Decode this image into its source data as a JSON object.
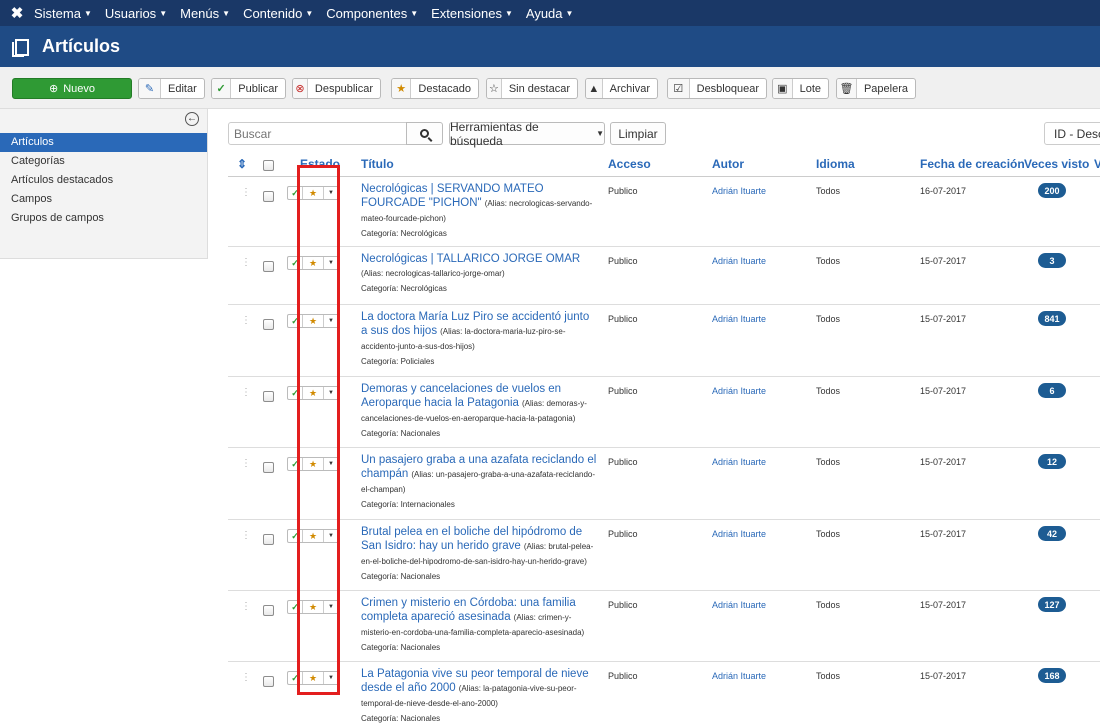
{
  "topnav": {
    "logo_icon": "joomla-logo-icon",
    "items": [
      "Sistema",
      "Usuarios",
      "Menús",
      "Contenido",
      "Componentes",
      "Extensiones",
      "Ayuda"
    ]
  },
  "page": {
    "title": "Artículos",
    "icon": "copy-icon"
  },
  "toolbar": {
    "new": "Nuevo",
    "edit": "Editar",
    "publish": "Publicar",
    "unpublish": "Despublicar",
    "feature": "Destacado",
    "unfeature": "Sin destacar",
    "archive": "Archivar",
    "checkin": "Desbloquear",
    "batch": "Lote",
    "trash": "Papelera"
  },
  "sidebar": {
    "items": [
      "Artículos",
      "Categorías",
      "Artículos destacados",
      "Campos",
      "Grupos de campos"
    ],
    "active_index": 0
  },
  "filters": {
    "search_placeholder": "Buscar",
    "search_tools": "Herramientas de búsqueda",
    "clear": "Limpiar",
    "ordering": "ID - Desce"
  },
  "table": {
    "headers": {
      "ordering": "⇕",
      "status": "Estado",
      "title": "Título",
      "access": "Acceso",
      "author": "Autor",
      "language": "Idioma",
      "created": "Fecha de creación",
      "hits": "Veces visto",
      "votes": "V"
    },
    "rows": [
      {
        "title": "Necrológicas | SERVANDO MATEO FOURCADE \"PICHON\"",
        "alias": "(Alias: necrologicas-servando-mateo-fourcade-pichon)",
        "category": "Categoría: Necrológicas",
        "access": "Publico",
        "author": "Adrián Ituarte",
        "language": "Todos",
        "created": "16-07-2017",
        "hits": "200"
      },
      {
        "title": "Necrológicas | TALLARICO JORGE OMAR",
        "alias": "(Alias: necrologicas-tallarico-jorge-omar)",
        "category": "Categoría: Necrológicas",
        "access": "Publico",
        "author": "Adrián Ituarte",
        "language": "Todos",
        "created": "15-07-2017",
        "hits": "3"
      },
      {
        "title": "La doctora María Luz Piro se accidentó junto a sus dos hijos",
        "alias": "(Alias: la-doctora-maria-luz-piro-se-accidento-junto-a-sus-dos-hijos)",
        "category": "Categoría: Policiales",
        "access": "Publico",
        "author": "Adrián Ituarte",
        "language": "Todos",
        "created": "15-07-2017",
        "hits": "841"
      },
      {
        "title": "Demoras y cancelaciones de vuelos en Aeroparque hacia la Patagonia",
        "alias": "(Alias: demoras-y-cancelaciones-de-vuelos-en-aeroparque-hacia-la-patagonia)",
        "category": "Categoría: Nacionales",
        "access": "Publico",
        "author": "Adrián Ituarte",
        "language": "Todos",
        "created": "15-07-2017",
        "hits": "6"
      },
      {
        "title": "Un pasajero graba a una azafata reciclando el champán",
        "alias": "(Alias: un-pasajero-graba-a-una-azafata-reciclando-el-champan)",
        "category": "Categoría: Internacionales",
        "access": "Publico",
        "author": "Adrián Ituarte",
        "language": "Todos",
        "created": "15-07-2017",
        "hits": "12"
      },
      {
        "title": "Brutal pelea en el boliche del hipódromo de San Isidro: hay un herido grave",
        "alias": "(Alias: brutal-pelea-en-el-boliche-del-hipodromo-de-san-isidro-hay-un-herido-grave)",
        "category": "Categoría: Nacionales",
        "access": "Publico",
        "author": "Adrián Ituarte",
        "language": "Todos",
        "created": "15-07-2017",
        "hits": "42"
      },
      {
        "title": "Crimen y misterio en Córdoba: una familia completa apareció asesinada",
        "alias": "(Alias: crimen-y-misterio-en-cordoba-una-familia-completa-aparecio-asesinada)",
        "category": "Categoría: Nacionales",
        "access": "Publico",
        "author": "Adrián Ituarte",
        "language": "Todos",
        "created": "15-07-2017",
        "hits": "127"
      },
      {
        "title": "La Patagonia vive su peor temporal de nieve desde el año 2000",
        "alias": "(Alias: la-patagonia-vive-su-peor-temporal-de-nieve-desde-el-ano-2000)",
        "category": "Categoría: Nacionales",
        "access": "Publico",
        "author": "Adrián Ituarte",
        "language": "Todos",
        "created": "15-07-2017",
        "hits": "168"
      }
    ]
  },
  "colors": {
    "topnav": "#1a3867",
    "titlebar": "#1f4b85",
    "new_button": "#2f9a34",
    "link": "#2a69b8",
    "hits_badge": "#1d5c93",
    "highlight": "#e31e1e"
  }
}
